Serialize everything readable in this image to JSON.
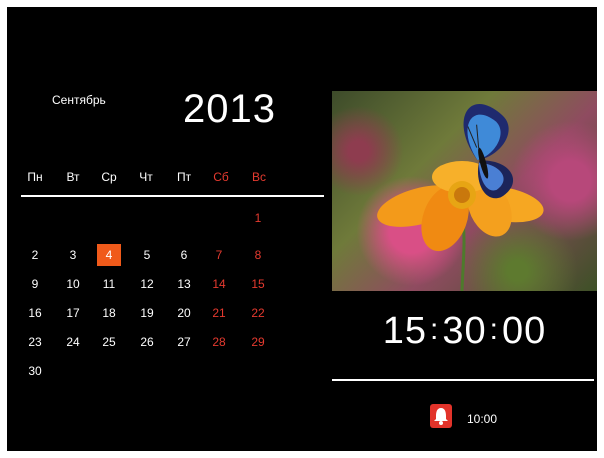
{
  "calendar": {
    "month": "Сентябрь",
    "year": "2013",
    "weekdays": [
      "Пн",
      "Вт",
      "Ср",
      "Чт",
      "Пт",
      "Сб",
      "Вс"
    ],
    "weeks": [
      [
        "",
        "",
        "",
        "",
        "",
        "",
        "1"
      ],
      [
        "2",
        "3",
        "4",
        "5",
        "6",
        "7",
        "8"
      ],
      [
        "9",
        "10",
        "11",
        "12",
        "13",
        "14",
        "15"
      ],
      [
        "16",
        "17",
        "18",
        "19",
        "20",
        "21",
        "22"
      ],
      [
        "23",
        "24",
        "25",
        "26",
        "27",
        "28",
        "29"
      ],
      [
        "30",
        "",
        "",
        "",
        "",
        "",
        ""
      ]
    ],
    "today": "4"
  },
  "clock": {
    "hours": "15",
    "minutes": "30",
    "seconds": "00"
  },
  "alarm": {
    "icon": "bell-icon",
    "time": "10:00"
  },
  "colors": {
    "weekend": "#e53a2f",
    "today_highlight": "#f05a1a",
    "alarm": "#e2332a"
  }
}
